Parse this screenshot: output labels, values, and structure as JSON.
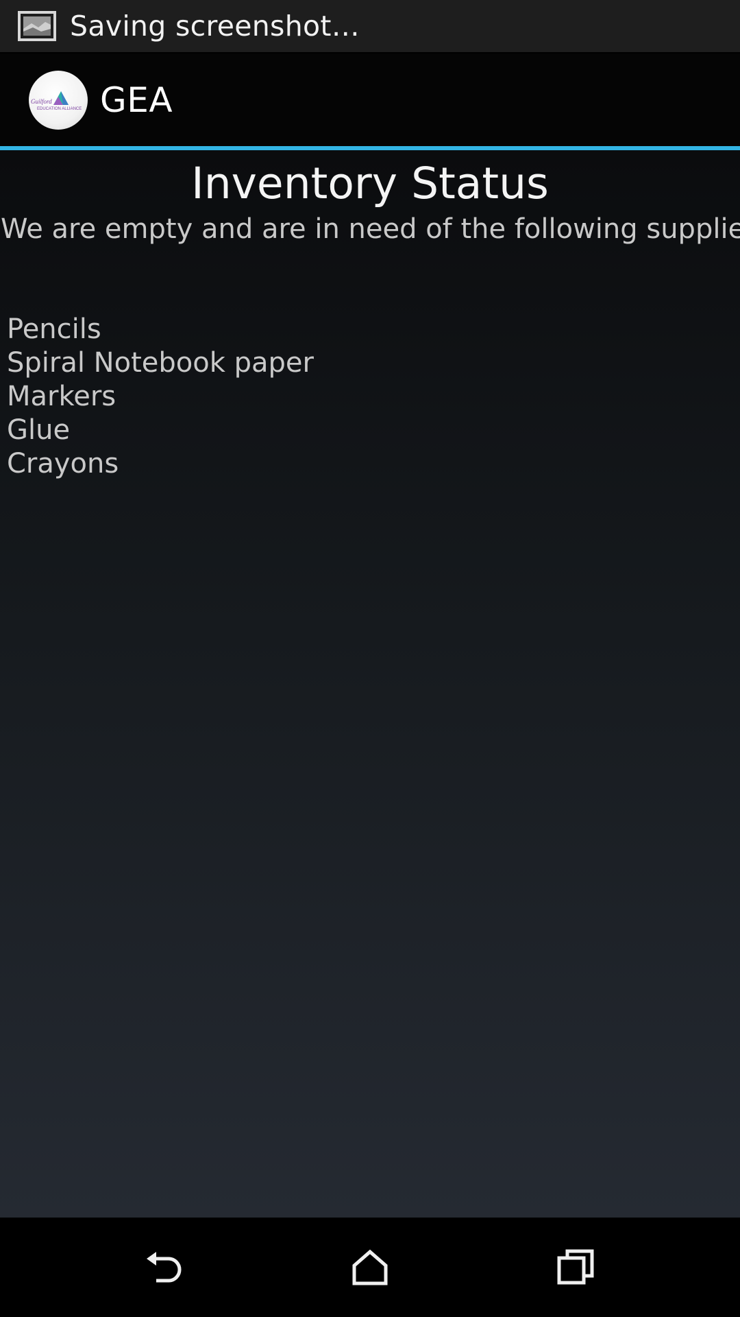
{
  "status_bar": {
    "icon": "screenshot-icon",
    "text": "Saving screenshot…"
  },
  "action_bar": {
    "logo": "gea-logo",
    "logo_text": "Guilford EDUCATION ALLIANCE",
    "title": "GEA"
  },
  "colors": {
    "accent": "#33b5e5",
    "logo_purple": "#7b3fa0",
    "logo_teal": "#2bb0a5"
  },
  "main": {
    "title": "Inventory Status",
    "subtitle": "We are empty and are in need of the following supplies:",
    "supplies": [
      "Pencils",
      "Spiral Notebook paper",
      "Markers",
      "Glue",
      "Crayons"
    ]
  },
  "nav_bar": {
    "back": "back-icon",
    "home": "home-icon",
    "recents": "recents-icon"
  }
}
